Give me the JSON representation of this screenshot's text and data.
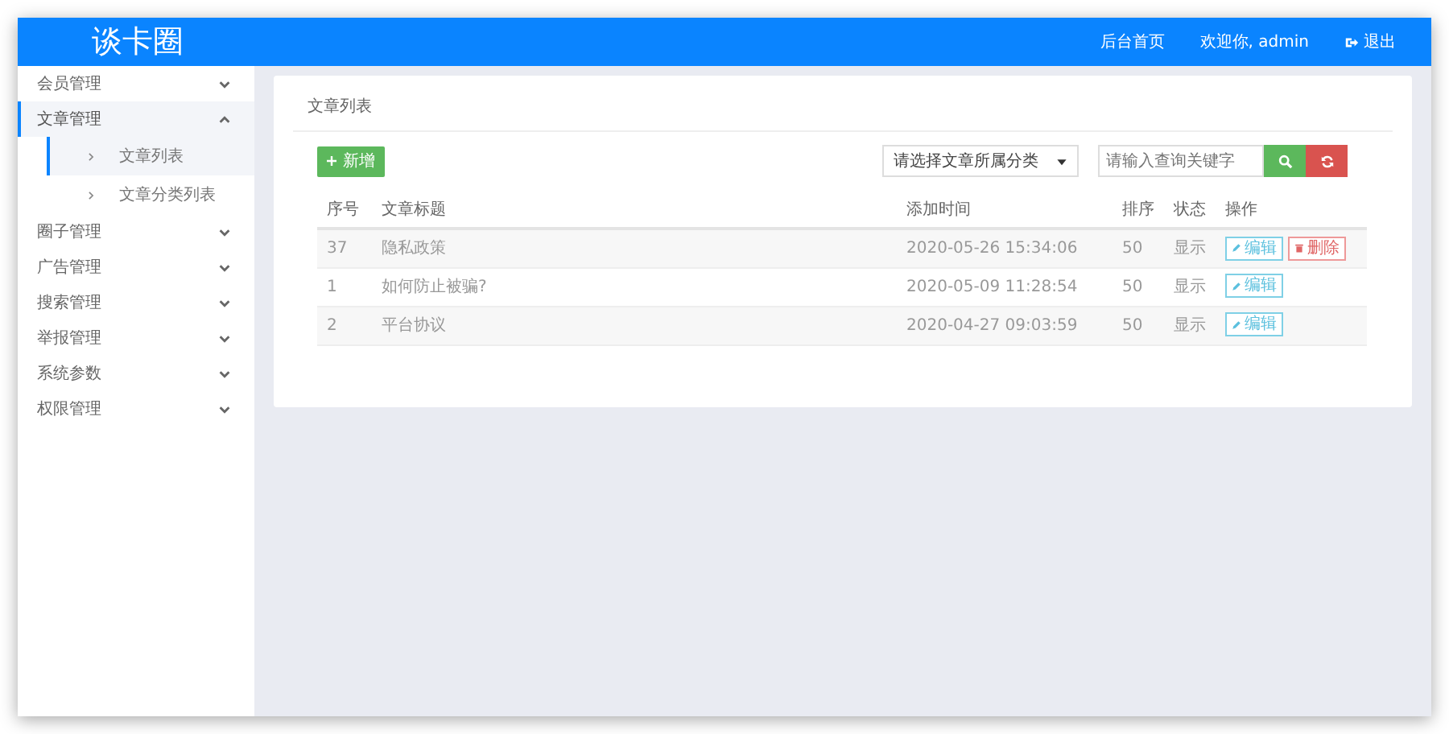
{
  "header": {
    "logo": "谈卡圈",
    "links": [
      {
        "kind": "link",
        "label": "后台首页"
      },
      {
        "kind": "link",
        "label": "欢迎你, admin"
      },
      {
        "kind": "logout",
        "label": "退出"
      }
    ]
  },
  "sidebar": {
    "items": [
      {
        "label": "会员管理",
        "expanded": false,
        "selected": false
      },
      {
        "label": "文章管理",
        "expanded": true,
        "selected": true,
        "children": [
          {
            "label": "文章列表",
            "selected": true
          },
          {
            "label": "文章分类列表",
            "selected": false
          }
        ]
      },
      {
        "label": "圈子管理",
        "expanded": false,
        "selected": false
      },
      {
        "label": "广告管理",
        "expanded": false,
        "selected": false
      },
      {
        "label": "搜索管理",
        "expanded": false,
        "selected": false
      },
      {
        "label": "举报管理",
        "expanded": false,
        "selected": false
      },
      {
        "label": "系统参数",
        "expanded": false,
        "selected": false
      },
      {
        "label": "权限管理",
        "expanded": false,
        "selected": false
      }
    ]
  },
  "panel": {
    "title": "文章列表",
    "add_button": "新增",
    "category_select": "请选择文章所属分类",
    "search": {
      "placeholder": "请输入查询关键字"
    },
    "table": {
      "columns": [
        "序号",
        "文章标题",
        "添加时间",
        "排序",
        "状态",
        "操作"
      ],
      "rows": [
        {
          "cells": [
            "37",
            "隐私政策",
            "2020-05-26 15:34:06",
            "50",
            "显示"
          ],
          "actions": [
            {
              "kind": "edit",
              "label": "编辑"
            },
            {
              "kind": "delete",
              "label": "删除"
            }
          ]
        },
        {
          "cells": [
            "1",
            "如何防止被骗?",
            "2020-05-09 11:28:54",
            "50",
            "显示"
          ],
          "actions": [
            {
              "kind": "edit",
              "label": "编辑"
            }
          ]
        },
        {
          "cells": [
            "2",
            "平台协议",
            "2020-04-27 09:03:59",
            "50",
            "显示"
          ],
          "actions": [
            {
              "kind": "edit",
              "label": "编辑"
            }
          ]
        }
      ]
    }
  }
}
